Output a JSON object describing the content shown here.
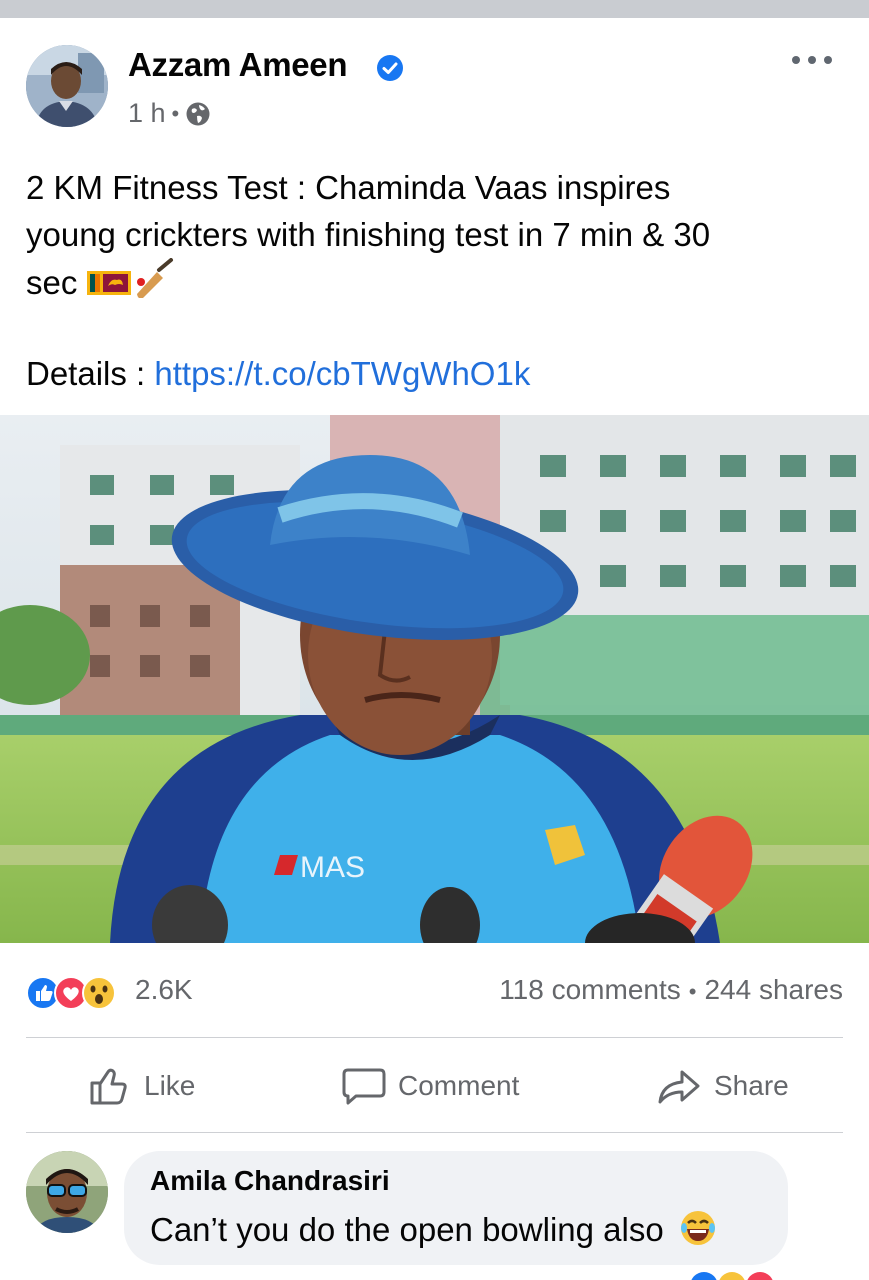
{
  "post": {
    "author": "Azzam Ameen",
    "verified": true,
    "time": "1 h",
    "time_separator": "•",
    "audience_icon": "globe-icon",
    "more_icon": "more-options-icon",
    "text_lines": [
      "2 KM Fitness Test : Chaminda Vaas inspires",
      "young crickters with finishing test in 7 min & 30",
      "sec"
    ],
    "text_emojis": [
      "sri-lanka-flag-icon",
      "cricket-bat-icon"
    ],
    "details_label": "Details : ",
    "details_link": "https://t.co/cbTWgWhO1k",
    "photo": {
      "shirt_text": "MAS"
    }
  },
  "reactions": {
    "icons": [
      "like-reaction-icon",
      "love-reaction-icon",
      "wow-reaction-icon"
    ],
    "count": "2.6K",
    "comments": "118 comments",
    "separator": "•",
    "shares": "244 shares"
  },
  "actions": {
    "like": "Like",
    "comment": "Comment",
    "share": "Share"
  },
  "comment": {
    "author": "Amila Chandrasiri",
    "text": "Can’t you do the open bowling also",
    "emoji": "laughing-emoji-icon"
  },
  "colors": {
    "link": "#216fdb",
    "secondary_text": "#65676b",
    "verified_blue": "#1877f2",
    "bubble": "#f0f2f5",
    "divider": "#ced0d4"
  }
}
